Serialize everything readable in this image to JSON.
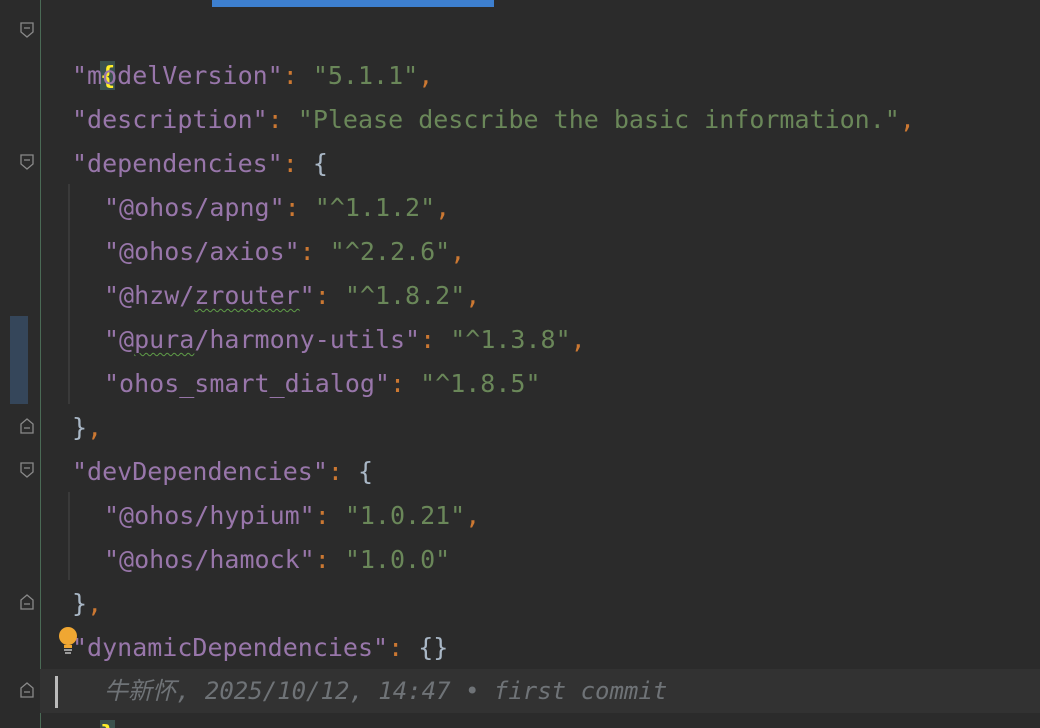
{
  "editor": {
    "colors": {
      "background": "#2b2b2b",
      "key": "#9876aa",
      "string": "#6a8759",
      "punctuation": "#cc7832",
      "brace_match": "#ffef28"
    },
    "lines": {
      "open_brace": "{",
      "model_version": {
        "key": "\"modelVersion\"",
        "colon": ": ",
        "value": "\"5.1.1\"",
        "comma": ","
      },
      "description": {
        "key": "\"description\"",
        "colon": ": ",
        "value": "\"Please describe the basic information.\"",
        "comma": ","
      },
      "dependencies": {
        "key": "\"dependencies\"",
        "colon": ": ",
        "open": "{"
      },
      "dep_apng": {
        "key_pre": "\"@ohos/apng\"",
        "colon": ": ",
        "value": "\"^1.1.2\"",
        "comma": ","
      },
      "dep_axios": {
        "key_pre": "\"@ohos/axios\"",
        "colon": ": ",
        "value": "\"^2.2.6\"",
        "comma": ","
      },
      "dep_zrouter": {
        "key_a": "\"@hzw/",
        "key_b": "zrouter",
        "key_c": "\"",
        "colon": ": ",
        "value": "\"^1.8.2\"",
        "comma": ","
      },
      "dep_harmony_utils": {
        "key_a": "\"@",
        "key_b": "pura",
        "key_c": "/harmony-utils\"",
        "colon": ": ",
        "value": "\"^1.3.8\"",
        "comma": ","
      },
      "dep_smart_dialog": {
        "key_pre": "\"ohos_smart_dialog\"",
        "colon": ": ",
        "value": "\"^1.8.5\""
      },
      "close_deps": {
        "brace": "}",
        "comma": ","
      },
      "dev_dependencies": {
        "key": "\"devDependencies\"",
        "colon": ": ",
        "open": "{"
      },
      "dev_hypium": {
        "key_pre": "\"@ohos/hypium\"",
        "colon": ": ",
        "value": "\"1.0.21\"",
        "comma": ","
      },
      "dev_hamock": {
        "key_pre": "\"@ohos/hamock\"",
        "colon": ": ",
        "value": "\"1.0.0\""
      },
      "close_dev": {
        "brace": "}",
        "comma": ","
      },
      "dynamic_dependencies": {
        "key": "\"dynamicDependencies\"",
        "colon": ": ",
        "value": "{}"
      },
      "close_brace": "}"
    },
    "blame": {
      "text": "牛新怀, 2025/10/12, 14:47 • first commit"
    },
    "icons": {
      "intention": "lightbulb-icon",
      "fold": "fold-marker-icon"
    }
  }
}
